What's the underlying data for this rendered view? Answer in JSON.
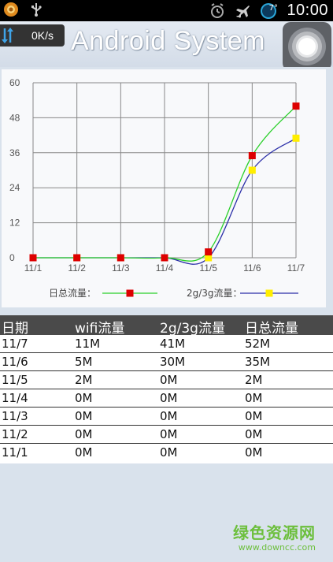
{
  "status_bar": {
    "time": "10:00",
    "weather_badge": "7°",
    "icons": [
      "app-notification-icon",
      "usb-icon",
      "alarm-icon",
      "airplane-mode-icon",
      "weather-icon"
    ]
  },
  "header": {
    "speed": "0K/s",
    "title": "Android System"
  },
  "chart_data": {
    "type": "line",
    "categories": [
      "11/1",
      "11/2",
      "11/3",
      "11/4",
      "11/5",
      "11/6",
      "11/7"
    ],
    "ylim": [
      0,
      60
    ],
    "yticks": [
      "0",
      "12",
      "24",
      "36",
      "48",
      "60"
    ],
    "grid": true,
    "legend_position": "bottom",
    "series": [
      {
        "name": "日总流量：",
        "color": "#2ad02a",
        "marker_color": "#dd0000",
        "values": [
          0,
          0,
          0,
          0,
          2,
          35,
          52
        ]
      },
      {
        "name": "2g/3g流量：",
        "color": "#2b2fa8",
        "marker_color": "#ffee00",
        "values": [
          0,
          0,
          0,
          0,
          0,
          30,
          41
        ]
      }
    ]
  },
  "table": {
    "headers": [
      "日期",
      "wifi流量",
      "2g/3g流量",
      "日总流量"
    ],
    "rows": [
      [
        "11/7",
        "11M",
        "41M",
        "52M"
      ],
      [
        "11/6",
        "5M",
        "30M",
        "35M"
      ],
      [
        "11/5",
        "2M",
        "0M",
        "2M"
      ],
      [
        "11/4",
        "0M",
        "0M",
        "0M"
      ],
      [
        "11/3",
        "0M",
        "0M",
        "0M"
      ],
      [
        "11/2",
        "0M",
        "0M",
        "0M"
      ],
      [
        "11/1",
        "0M",
        "0M",
        "0M"
      ]
    ]
  },
  "watermark": {
    "text": "绿色资源网",
    "url": "www.downcc.com"
  }
}
